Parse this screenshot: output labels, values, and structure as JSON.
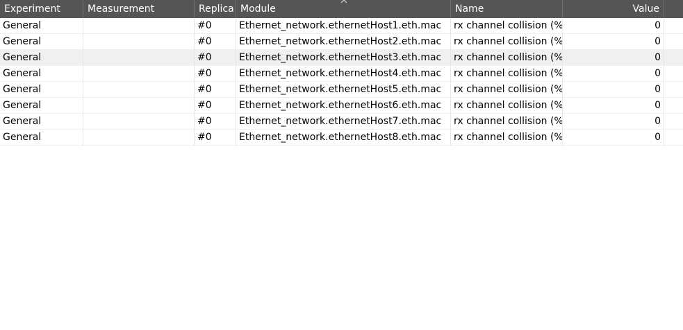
{
  "columns": {
    "experiment": "Experiment",
    "measurement": "Measurement",
    "replication": "Replica",
    "module": "Module",
    "name": "Name",
    "value": "Value"
  },
  "rows": [
    {
      "experiment": "General",
      "measurement": "",
      "replication": "#0",
      "module": "Ethernet_network.ethernetHost1.eth.mac",
      "name": "rx channel collision (%)",
      "value": "0"
    },
    {
      "experiment": "General",
      "measurement": "",
      "replication": "#0",
      "module": "Ethernet_network.ethernetHost2.eth.mac",
      "name": "rx channel collision (%)",
      "value": "0"
    },
    {
      "experiment": "General",
      "measurement": "",
      "replication": "#0",
      "module": "Ethernet_network.ethernetHost3.eth.mac",
      "name": "rx channel collision (%)",
      "value": "0"
    },
    {
      "experiment": "General",
      "measurement": "",
      "replication": "#0",
      "module": "Ethernet_network.ethernetHost4.eth.mac",
      "name": "rx channel collision (%)",
      "value": "0"
    },
    {
      "experiment": "General",
      "measurement": "",
      "replication": "#0",
      "module": "Ethernet_network.ethernetHost5.eth.mac",
      "name": "rx channel collision (%)",
      "value": "0"
    },
    {
      "experiment": "General",
      "measurement": "",
      "replication": "#0",
      "module": "Ethernet_network.ethernetHost6.eth.mac",
      "name": "rx channel collision (%)",
      "value": "0"
    },
    {
      "experiment": "General",
      "measurement": "",
      "replication": "#0",
      "module": "Ethernet_network.ethernetHost7.eth.mac",
      "name": "rx channel collision (%)",
      "value": "0"
    },
    {
      "experiment": "General",
      "measurement": "",
      "replication": "#0",
      "module": "Ethernet_network.ethernetHost8.eth.mac",
      "name": "rx channel collision (%)",
      "value": "0"
    }
  ],
  "selected_row": 2,
  "colors": {
    "header_bg": "#555555",
    "header_text": "#ffffff",
    "row_highlight": "#f0f0f0"
  },
  "icons": {
    "sort": "sort-ascending-chevron-icon"
  }
}
